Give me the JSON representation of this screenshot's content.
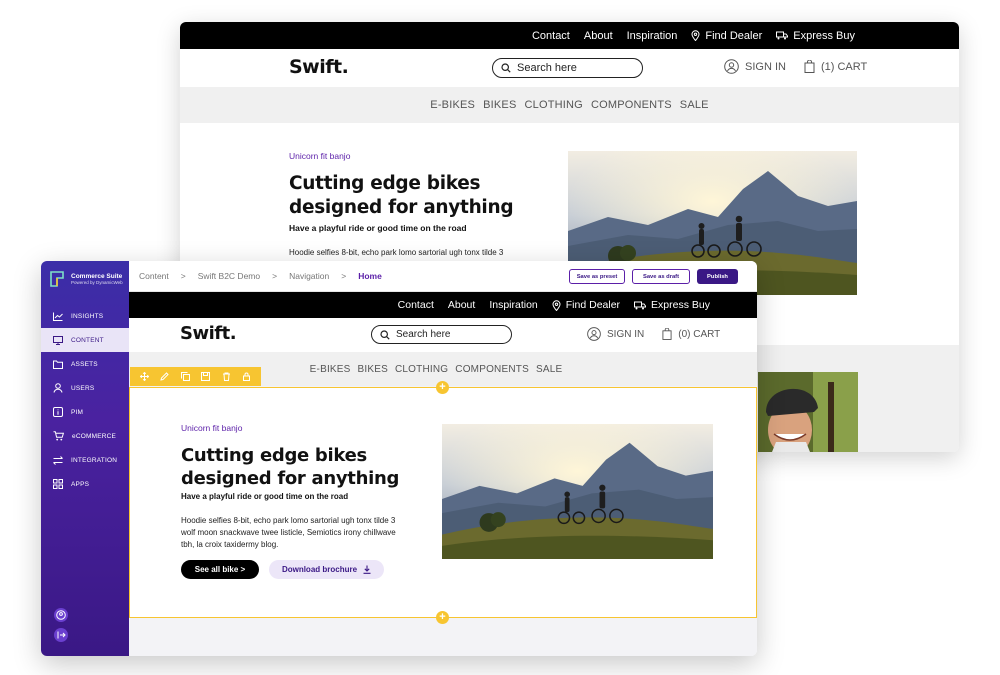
{
  "site": {
    "logo": "Swift.",
    "top_links": [
      "Contact",
      "About",
      "Inspiration"
    ],
    "find_dealer": "Find Dealer",
    "express_buy": "Express Buy",
    "search_placeholder": "Search here",
    "sign_in": "SIGN IN",
    "cart": "(1) CART",
    "categories": [
      "E-BIKES",
      "BIKES",
      "CLOTHING",
      "COMPONENTS",
      "SALE"
    ],
    "eyebrow": "Unicorn fit banjo",
    "hero_line1": "Cutting edge bikes",
    "hero_line2": "designed for anything",
    "subheading": "Have a playful ride or good time on the road",
    "body_back": "Hoodie selfies 8-bit, echo park lomo sartorial ugh tonx tilde 3",
    "body": [
      "Hoodie selfies 8-bit, echo park lomo sartorial ugh tonx tilde 3",
      "wolf moon snackwave twee listicle, Semiotics irony chillwave",
      "tbh, la croix taxidermy blog."
    ],
    "cta_primary": "See all bike >",
    "cta_secondary": "Download brochure"
  },
  "editor_site": {
    "cart": "(0) CART"
  },
  "cms": {
    "brand_name": "Commerce Suite",
    "brand_tagline": "Powered by DynamicWeb",
    "nav": [
      {
        "label": "INSIGHTS",
        "icon": "chart-icon"
      },
      {
        "label": "CONTENT",
        "icon": "monitor-icon"
      },
      {
        "label": "ASSETS",
        "icon": "folder-icon"
      },
      {
        "label": "USERS",
        "icon": "user-icon"
      },
      {
        "label": "PIM",
        "icon": "info-icon"
      },
      {
        "label": "eCOMMERCE",
        "icon": "cart-icon"
      },
      {
        "label": "INTEGRATION",
        "icon": "swap-icon"
      },
      {
        "label": "APPS",
        "icon": "grid-icon"
      }
    ],
    "active_nav": "CONTENT",
    "breadcrumb": [
      "Content",
      "Swift B2C Demo",
      "Navigation",
      "Home"
    ],
    "breadcrumb_sep": ">",
    "buttons": {
      "save_preset": "Save as preset",
      "save_draft": "Save as draft",
      "publish": "Publish"
    },
    "colors": {
      "sidebar": "#3b2ea8",
      "accent": "#5b1fa8",
      "toolbar": "#f7c531"
    }
  }
}
